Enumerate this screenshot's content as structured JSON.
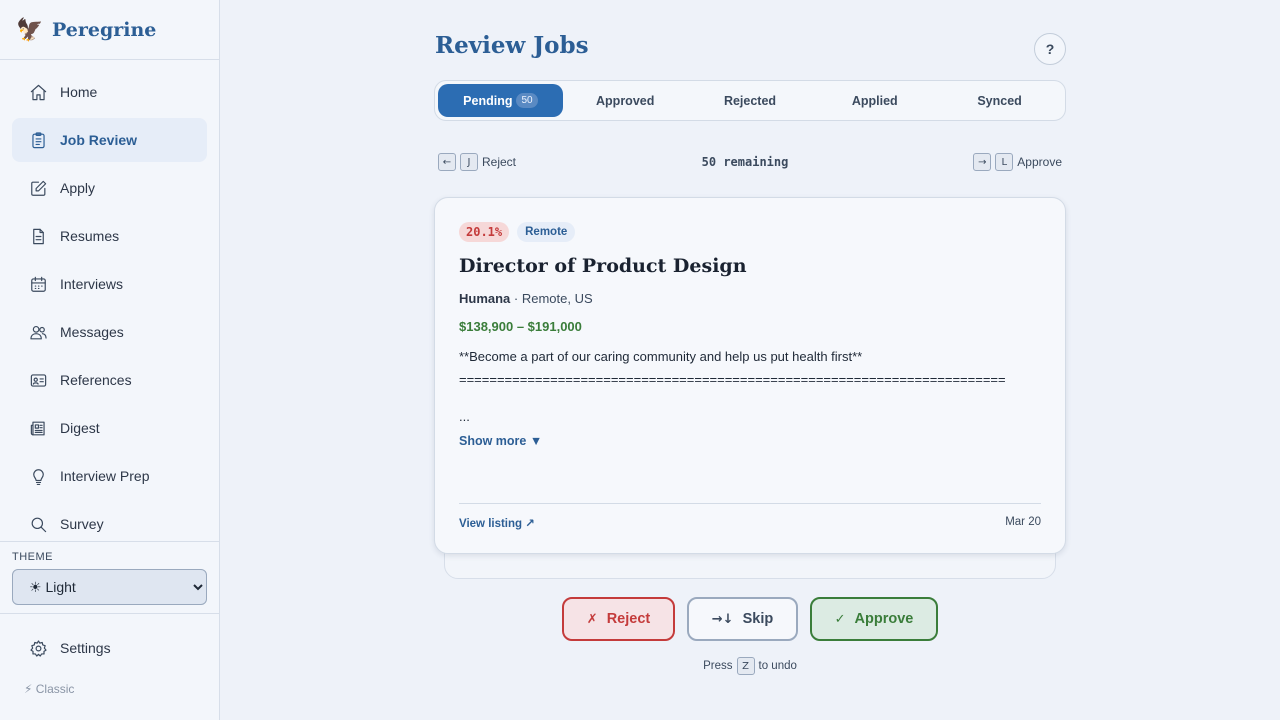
{
  "brand": {
    "name": "Peregrine",
    "logo": "🦅"
  },
  "sidebar": {
    "items": [
      {
        "label": "Home",
        "icon": "home-icon"
      },
      {
        "label": "Job Review",
        "icon": "clipboard-icon",
        "active": true
      },
      {
        "label": "Apply",
        "icon": "edit-icon"
      },
      {
        "label": "Resumes",
        "icon": "document-icon"
      },
      {
        "label": "Interviews",
        "icon": "calendar-icon"
      },
      {
        "label": "Messages",
        "icon": "users-icon"
      },
      {
        "label": "References",
        "icon": "id-card-icon"
      },
      {
        "label": "Digest",
        "icon": "newspaper-icon"
      },
      {
        "label": "Interview Prep",
        "icon": "lightbulb-icon"
      },
      {
        "label": "Survey",
        "icon": "search-icon"
      }
    ],
    "theme_label": "THEME",
    "theme_value": "☀ Light",
    "settings_label": "Settings",
    "classic_label": "⚡ Classic"
  },
  "header": {
    "title": "Review Jobs",
    "help_label": "?"
  },
  "tabs": [
    {
      "label": "Pending",
      "count": "50",
      "active": true
    },
    {
      "label": "Approved"
    },
    {
      "label": "Rejected"
    },
    {
      "label": "Applied"
    },
    {
      "label": "Synced"
    }
  ],
  "hints": {
    "left_arrow": "←",
    "left_key": "J",
    "left_label": "Reject",
    "remaining": "50 remaining",
    "right_arrow": "→",
    "right_key": "L",
    "right_label": "Approve"
  },
  "job": {
    "score": "20.1%",
    "remote_badge": "Remote",
    "title": "Director of Product Design",
    "company": "Humana",
    "location": "· Remote, US",
    "salary": "$138,900 – $191,000",
    "desc_line1": "**Become a part of our caring community and help us put health first**",
    "desc_line2": "========================================================================",
    "ellipsis": "...",
    "show_more": "Show more ▼",
    "view_listing": "View listing ↗",
    "date": "Mar 20"
  },
  "actions": {
    "reject_glyph": "✗",
    "reject_label": "Reject",
    "skip_glyph": "→↓",
    "skip_label": "Skip",
    "approve_glyph": "✓",
    "approve_label": "Approve"
  },
  "undo": {
    "prefix": "Press",
    "key": "Z",
    "suffix": "to undo"
  }
}
